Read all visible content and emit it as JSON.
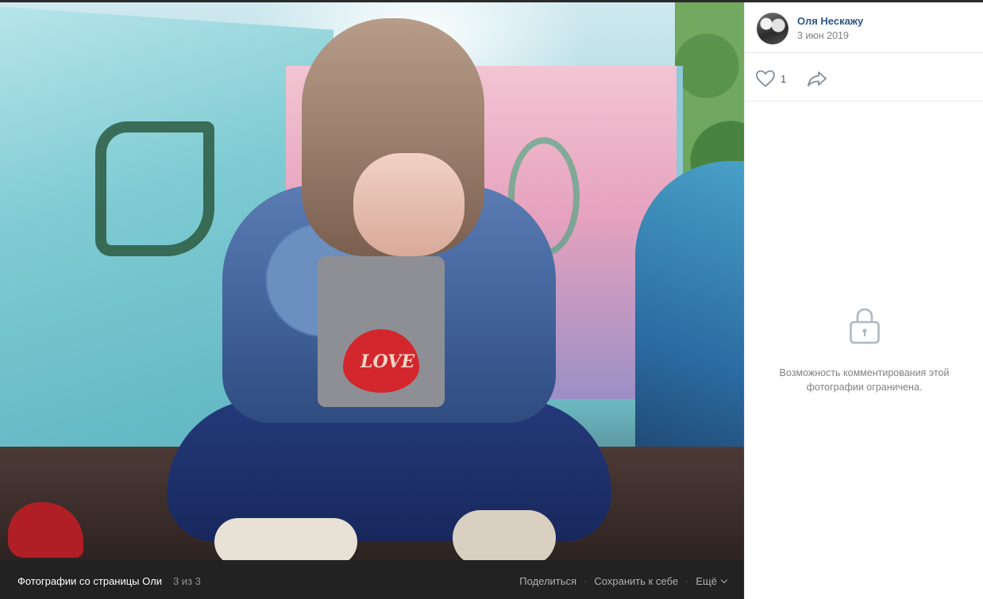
{
  "photo": {
    "shirt_text": "LOVE"
  },
  "bottom_bar": {
    "album_title": "Фотографии со страницы Оли",
    "counter": "3 из 3",
    "share_label": "Поделиться",
    "save_label": "Сохранить к себе",
    "more_label": "Ещё",
    "separator": "·"
  },
  "author": {
    "name": "Оля Нескажу",
    "date": "3 июн 2019"
  },
  "likes": {
    "count": "1",
    "icon": "heart-icon",
    "share_icon": "share-arrow-icon"
  },
  "comments": {
    "icon": "lock-icon",
    "restricted_text": "Возможность комментирования этой фотографии ограничена."
  },
  "colors": {
    "link": "#2a5885",
    "muted": "#828282",
    "bar_bg": "#222222"
  }
}
